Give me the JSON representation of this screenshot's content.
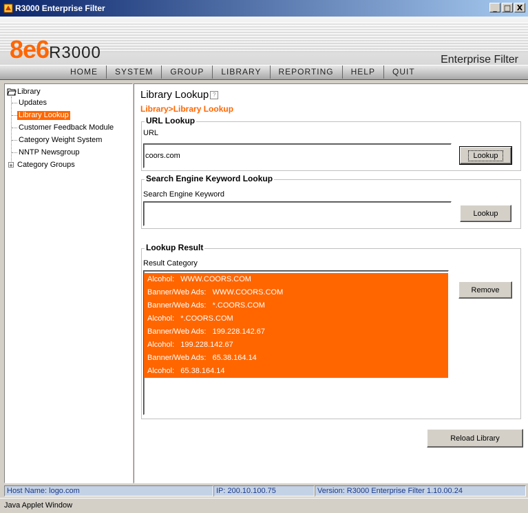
{
  "window": {
    "title": "R3000 Enterprise Filter",
    "controls": {
      "minimize": "_",
      "maximize": "□",
      "close": "X"
    }
  },
  "banner": {
    "logo_brand": "8e6",
    "logo_product": "R3000",
    "product_name": "Enterprise Filter"
  },
  "nav": {
    "items": [
      "HOME",
      "SYSTEM",
      "GROUP",
      "LIBRARY",
      "REPORTING",
      "HELP",
      "QUIT"
    ]
  },
  "tree": {
    "root": "Library",
    "items": [
      "Updates",
      "Library Lookup",
      "Customer Feedback Module",
      "Category Weight System",
      "NNTP Newsgroup",
      "Category Groups"
    ],
    "selected": "Library Lookup",
    "expand_symbol": "+"
  },
  "main": {
    "title": "Library Lookup",
    "help_symbol": "?",
    "breadcrumb": "Library>Library Lookup",
    "url_lookup": {
      "legend": "URL Lookup",
      "field_label": "URL",
      "value": "coors.com",
      "button": "Lookup"
    },
    "keyword_lookup": {
      "legend": "Search Engine Keyword Lookup",
      "field_label": "Search Engine Keyword",
      "value": "",
      "button": "Lookup"
    },
    "result": {
      "legend": "Lookup Result",
      "field_label": "Result Category",
      "items": [
        "Alcohol:   WWW.COORS.COM",
        "Banner/Web Ads:   WWW.COORS.COM",
        "Banner/Web Ads:   *.COORS.COM",
        "Alcohol:   *.COORS.COM",
        "Banner/Web Ads:   199.228.142.67",
        "Alcohol:   199.228.142.67",
        "Banner/Web Ads:   65.38.164.14",
        "Alcohol:   65.38.164.14"
      ],
      "remove_button": "Remove"
    },
    "reload_button": "Reload Library"
  },
  "status": {
    "host": "Host Name: logo.com",
    "ip": "IP: 200.10.100.75",
    "version": "Version: R3000 Enterprise Filter 1.10.00.24"
  },
  "java_bar": "Java Applet Window",
  "colors": {
    "accent": "#ff6600",
    "titlebar": "#0a246a",
    "status_bg": "#c4d2e6"
  }
}
